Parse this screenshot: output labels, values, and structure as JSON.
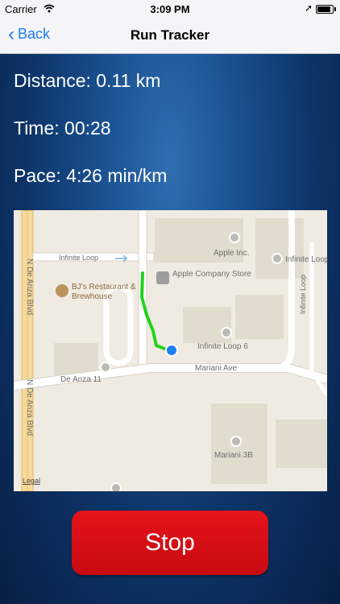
{
  "status": {
    "carrier": "Carrier",
    "time": "3:09 PM",
    "battery_level": 0.9
  },
  "nav": {
    "back_label": "Back",
    "title": "Run Tracker"
  },
  "stats": {
    "distance": "Distance: 0.11 km",
    "time": "Time: 00:28",
    "pace": "Pace: 4:26 min/km"
  },
  "map": {
    "labels": {
      "de_anza_blvd": "N De Anza Blvd",
      "de_anza_blvd_2": "N De Anza Blvd",
      "infinite_loop_road": "Infinite Loop",
      "infinite_loop_right": "Infinite Loop",
      "infinite_loop_vertical": "Infinite Loop",
      "apple_inc": "Apple Inc.",
      "apple_store": "Apple Company Store",
      "bjs": "BJ's Restaurant & Brewhouse",
      "infinite_loop_6": "Infinite Loop 6",
      "mariani_ave": "Mariani Ave",
      "de_anza_11": "De Anza 11",
      "mariani_3b": "Mariani 3B",
      "legal": "Legal"
    },
    "route_color": "#22d31b",
    "location_color": "#1f7ef2"
  },
  "stop_button": {
    "label": "Stop",
    "color": "#d90f16"
  }
}
